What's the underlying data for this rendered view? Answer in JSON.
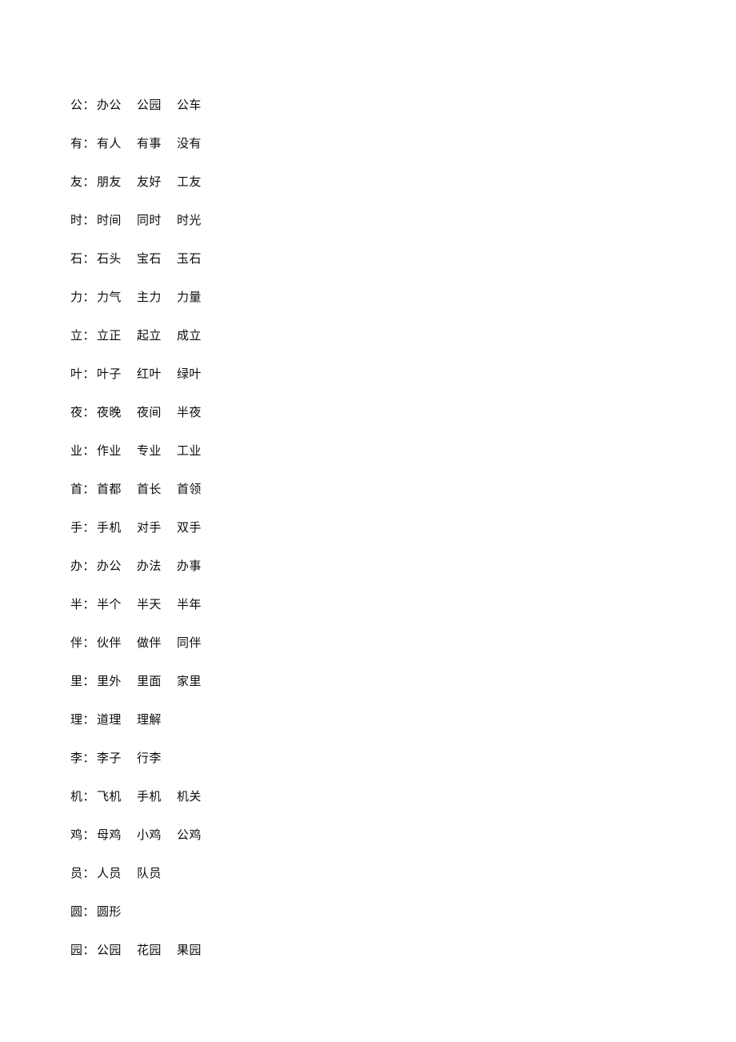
{
  "document": {
    "type": "vocabulary-worksheet",
    "separator": "：",
    "text_color": "#0d0d0d",
    "background_color": "#ffffff",
    "rows": [
      {
        "headword": "公",
        "words": [
          "办公",
          "公园",
          "公车"
        ]
      },
      {
        "headword": "有",
        "words": [
          "有人",
          "有事",
          "没有"
        ]
      },
      {
        "headword": "友",
        "words": [
          "朋友",
          "友好",
          "工友"
        ]
      },
      {
        "headword": "时",
        "words": [
          "时间",
          "同时",
          "时光"
        ]
      },
      {
        "headword": "石",
        "words": [
          "石头",
          "宝石",
          "玉石"
        ]
      },
      {
        "headword": "力",
        "words": [
          "力气",
          "主力",
          "力量"
        ]
      },
      {
        "headword": "立",
        "words": [
          "立正",
          "起立",
          "成立"
        ]
      },
      {
        "headword": "叶",
        "words": [
          "叶子",
          "红叶",
          "绿叶"
        ]
      },
      {
        "headword": "夜",
        "words": [
          "夜晚",
          "夜间",
          "半夜"
        ]
      },
      {
        "headword": "业",
        "words": [
          "作业",
          "专业",
          "工业"
        ]
      },
      {
        "headword": "首",
        "words": [
          "首都",
          "首长",
          "首领"
        ]
      },
      {
        "headword": "手",
        "words": [
          "手机",
          "对手",
          "双手"
        ]
      },
      {
        "headword": "办",
        "words": [
          "办公",
          "办法",
          "办事"
        ]
      },
      {
        "headword": "半",
        "words": [
          "半个",
          "半天",
          "半年"
        ]
      },
      {
        "headword": "伴",
        "words": [
          "伙伴",
          "做伴",
          "同伴"
        ]
      },
      {
        "headword": "里",
        "words": [
          "里外",
          "里面",
          "家里"
        ]
      },
      {
        "headword": "理",
        "words": [
          "道理",
          "理解"
        ]
      },
      {
        "headword": "李",
        "words": [
          "李子",
          "行李"
        ]
      },
      {
        "headword": "机",
        "words": [
          "飞机",
          "手机",
          "机关"
        ]
      },
      {
        "headword": "鸡",
        "words": [
          "母鸡",
          "小鸡",
          "公鸡"
        ]
      },
      {
        "headword": "员",
        "words": [
          "人员",
          "队员"
        ]
      },
      {
        "headword": "圆",
        "words": [
          "圆形"
        ]
      },
      {
        "headword": "园",
        "words": [
          "公园",
          "花园",
          "果园"
        ]
      }
    ]
  }
}
